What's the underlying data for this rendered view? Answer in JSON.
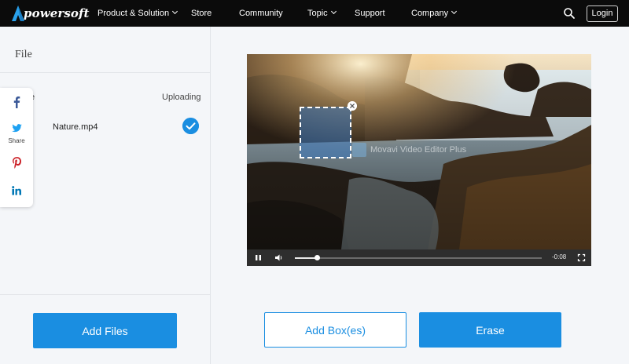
{
  "nav": {
    "logo_text": "powersoft",
    "logo_letter": "A",
    "items": [
      {
        "label": "Product & Solution",
        "dropdown": true
      },
      {
        "label": "Store",
        "dropdown": false
      },
      {
        "label": "Community",
        "dropdown": false
      },
      {
        "label": "Topic",
        "dropdown": true
      },
      {
        "label": "Support",
        "dropdown": false
      },
      {
        "label": "Company",
        "dropdown": true
      }
    ],
    "search_icon": "search-icon",
    "login_label": "Login"
  },
  "file_panel": {
    "heading": "File",
    "column_name_visible": "e",
    "column_status": "Uploading",
    "files": [
      {
        "name": "Nature.mp4",
        "status_icon": "check-circle-icon"
      }
    ],
    "add_files_label": "Add Files"
  },
  "social": {
    "items": [
      "facebook-icon",
      "twitter-icon",
      "pinterest-icon",
      "linkedin-icon"
    ],
    "share_label": "Share"
  },
  "video": {
    "watermark_text": "Movavi Video Editor Plus",
    "time_remaining": "-0:08",
    "progress": 0.09
  },
  "actions": {
    "add_box_label": "Add Box(es)",
    "erase_label": "Erase"
  },
  "colors": {
    "accent": "#1a8ee1",
    "nav_bg": "#0b0b0b",
    "panel_bg": "#f4f6f9"
  }
}
